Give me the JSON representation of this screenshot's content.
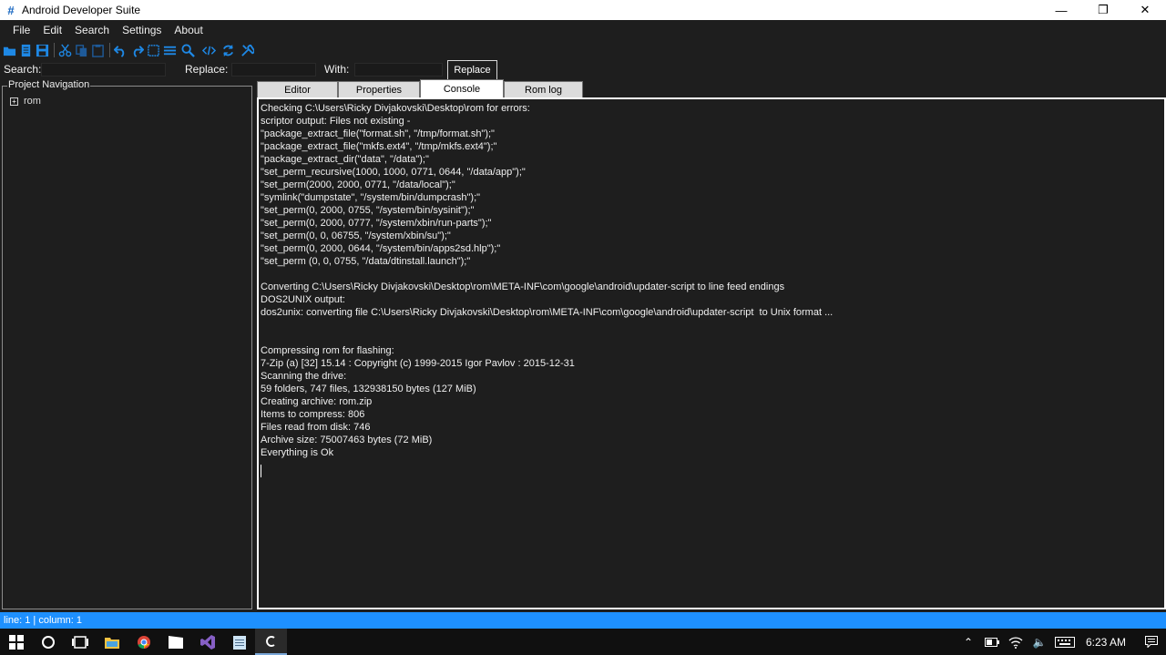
{
  "window": {
    "title": "Android Developer Suite",
    "app_icon_glyph": "#",
    "minimize_glyph": "—",
    "restore_glyph": "❐",
    "close_glyph": "✕"
  },
  "menu": [
    "File",
    "Edit",
    "Search",
    "Settings",
    "About"
  ],
  "toolbar_icons": [
    "open-folder-icon",
    "new-file-icon",
    "save-icon",
    "cut-icon",
    "copy-icon",
    "paste-icon",
    "undo-icon",
    "redo-icon",
    "select-all-icon",
    "format-lines-icon",
    "search-icon",
    "code-icon",
    "refresh-icon",
    "tools-icon"
  ],
  "search": {
    "search_label": "Search:",
    "replace_label": "Replace:",
    "with_label": "With:",
    "search_value": "",
    "replace_value": "",
    "with_value": "",
    "replace_button": "Replace"
  },
  "project": {
    "legend": "Project Navigation",
    "expander_glyph": "+",
    "root": "rom"
  },
  "tabs": [
    "Editor",
    "Properties",
    "Console",
    "Rom log"
  ],
  "active_tab": "Console",
  "console_lines": [
    "Checking C:\\Users\\Ricky Divjakovski\\Desktop\\rom for errors:",
    "scriptor output: Files not existing -",
    "\"package_extract_file(\"format.sh\", \"/tmp/format.sh\");\"",
    "\"package_extract_file(\"mkfs.ext4\", \"/tmp/mkfs.ext4\");\"",
    "\"package_extract_dir(\"data\", \"/data\");\"",
    "\"set_perm_recursive(1000, 1000, 0771, 0644, \"/data/app\");\"",
    "\"set_perm(2000, 2000, 0771, \"/data/local\");\"",
    "\"symlink(\"dumpstate\", \"/system/bin/dumpcrash\");\"",
    "\"set_perm(0, 2000, 0755, \"/system/bin/sysinit\");\"",
    "\"set_perm(0, 2000, 0777, \"/system/xbin/run-parts\");\"",
    "\"set_perm(0, 0, 06755, \"/system/xbin/su\");\"",
    "\"set_perm(0, 2000, 0644, \"/system/bin/apps2sd.hlp\");\"",
    "\"set_perm (0, 0, 0755, \"/data/dtinstall.launch\");\"",
    "",
    "Converting C:\\Users\\Ricky Divjakovski\\Desktop\\rom\\META-INF\\com\\google\\android\\updater-script to line feed endings",
    "DOS2UNIX output:",
    "dos2unix: converting file C:\\Users\\Ricky Divjakovski\\Desktop\\rom\\META-INF\\com\\google\\android\\updater-script  to Unix format ...",
    "",
    "",
    "Compressing rom for flashing:",
    "7-Zip (a) [32] 15.14 : Copyright (c) 1999-2015 Igor Pavlov : 2015-12-31",
    "Scanning the drive:",
    "59 folders, 747 files, 132938150 bytes (127 MiB)",
    "Creating archive: rom.zip",
    "Items to compress: 806",
    "Files read from disk: 746",
    "Archive size: 75007463 bytes (72 MiB)",
    "Everything is Ok"
  ],
  "status": "line: 1 | column: 1",
  "taskbar": {
    "apps": [
      "start-icon",
      "cortana-icon",
      "task-view-icon",
      "file-explorer-icon",
      "chrome-icon",
      "movies-icon",
      "visual-studio-icon",
      "notepad-icon",
      "cmd-icon"
    ],
    "active_app": "cmd-icon",
    "tray": [
      "chevron-up-icon",
      "battery-icon",
      "wifi-icon",
      "volume-icon",
      "keyboard-icon"
    ],
    "tray_glyphs": {
      "chevron": "⌃",
      "volume": "🔈"
    },
    "clock": "6:23 AM"
  },
  "colors": {
    "background": "#1e1e1e",
    "status_bar": "#1e90ff",
    "accent_icon": "#1e88e5"
  }
}
